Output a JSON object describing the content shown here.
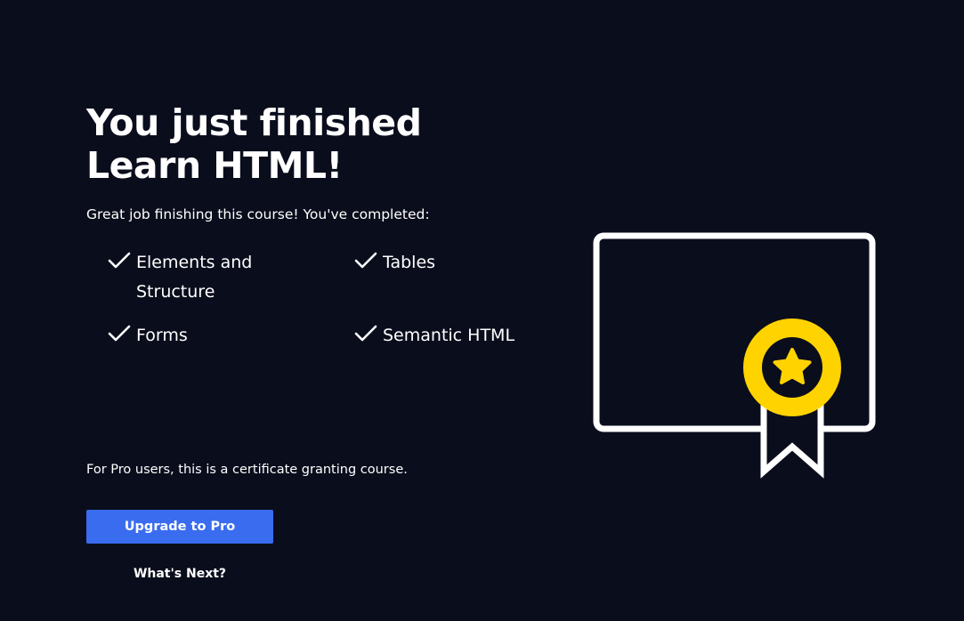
{
  "heading": {
    "line1": "You just finished",
    "line2": "Learn HTML!"
  },
  "subtitle": "Great job finishing this course! You've completed:",
  "lessons": [
    {
      "line1": "Elements and",
      "line2": "Structure"
    },
    {
      "line1": "Tables"
    },
    {
      "line1": "Forms"
    },
    {
      "line1": "Semantic HTML"
    }
  ],
  "pro_note": "For Pro users, this is a certificate granting course.",
  "buttons": {
    "upgrade_label": "Upgrade to Pro",
    "whats_next_label": "What's Next?"
  },
  "icons": {
    "check": "check-icon",
    "certificate": "certificate-icon",
    "medal": "medal-icon",
    "star": "star-icon",
    "ribbon": "ribbon-icon"
  },
  "colors": {
    "background": "#0a0d1c",
    "text": "#ffffff",
    "accent_button": "#3a6cf0",
    "medal": "#ffd300"
  }
}
